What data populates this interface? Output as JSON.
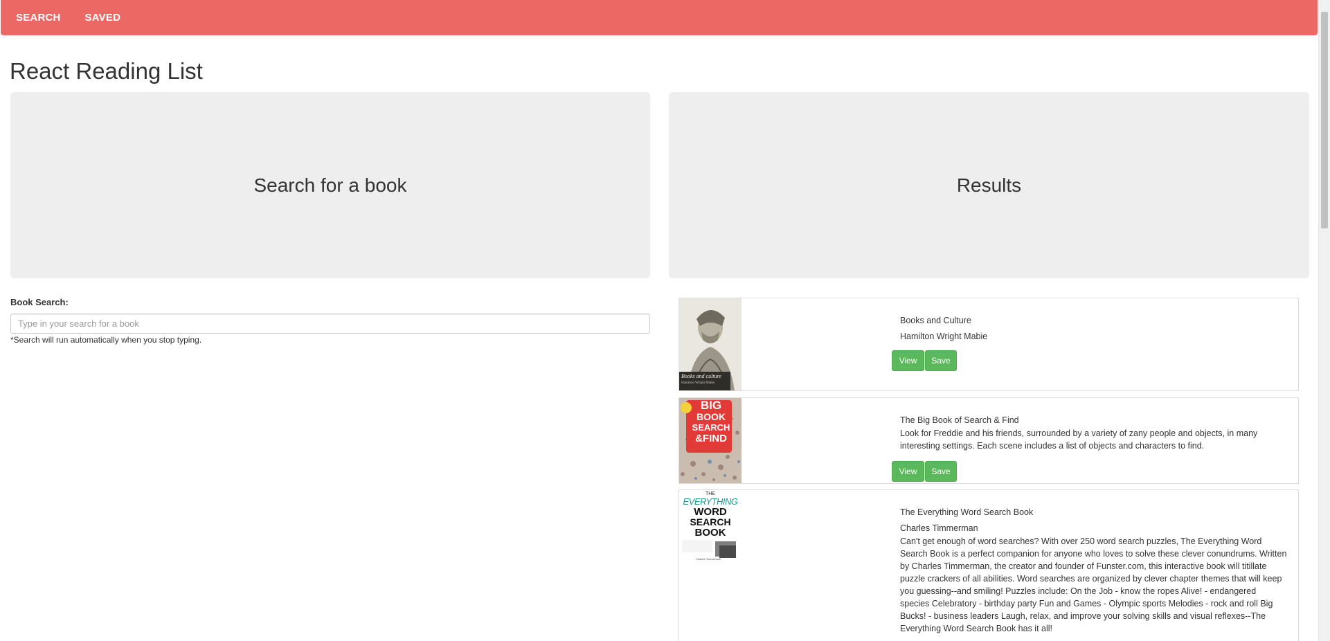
{
  "nav": {
    "search_label": "SEARCH",
    "saved_label": "SAVED",
    "bar_color": "#ec6865"
  },
  "page_title": "React Reading List",
  "search_panel": {
    "heading": "Search for a book",
    "label": "Book Search:",
    "placeholder": "Type in your search for a book",
    "value": "",
    "hint": "*Search will run automatically when you stop typing."
  },
  "results_panel": {
    "heading": "Results"
  },
  "books": [
    {
      "title": "Books and Culture",
      "author": "Hamilton Wright Mabie",
      "description": "",
      "cover_text": "Books and culture",
      "cover_subtext": "Hamilton Wright Mabie",
      "view_label": "View",
      "save_label": "Save"
    },
    {
      "title": "The Big Book of Search & Find",
      "author": "",
      "description": "Look for Freddie and his friends, surrounded by a variety of zany people and objects, in many interesting settings. Each scene includes a list of objects and characters to find.",
      "cover_line1": "BIG",
      "cover_line2": "BOOK",
      "cover_line3": "SEARCH",
      "cover_line4": "&FIND",
      "view_label": "View",
      "save_label": "Save"
    },
    {
      "title": "The Everything Word Search Book",
      "author": "Charles Timmerman",
      "description": "Can't get enough of word searches? With over 250 word search puzzles, The Everything Word Search Book is a perfect companion for anyone who loves to solve these clever conundrums. Written by Charles Timmerman, the creator and founder of Funster.com, this interactive book will titillate puzzle crackers of all abilities. Word searches are organized by clever chapter themes that will keep you guessing--and smiling! Puzzles include: On the Job - know the ropes Alive! - endangered species Celebratory - birthday party Fun and Games - Olympic sports Melodies - rock and roll Big Bucks! - business leaders Laugh, relax, and improve your solving skills and visual reflexes--The Everything Word Search Book has it all!",
      "cover_top": "THE",
      "cover_line1": "EVERYTHING",
      "cover_line2": "WORD",
      "cover_line3": "SEARCH",
      "cover_line4": "BOOK",
      "cover_author": "Charles Timmerman"
    }
  ],
  "colors": {
    "jumbotron": "#eeeeee",
    "button": "#5cb85c"
  }
}
